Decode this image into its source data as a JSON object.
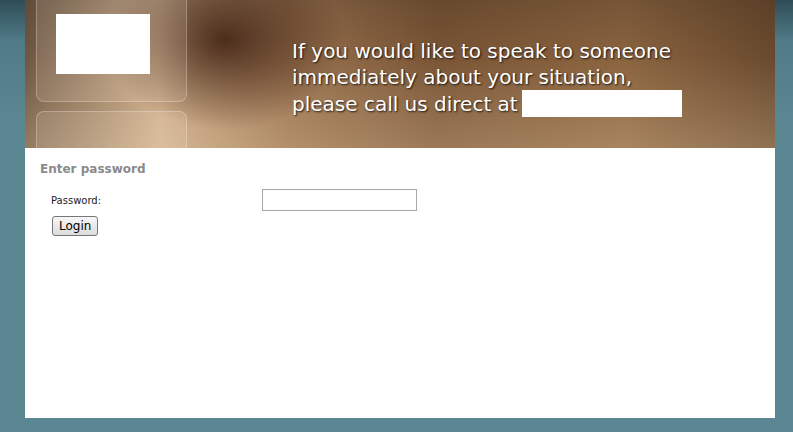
{
  "header": {
    "message_lines": [
      "If you would like to speak to someone",
      "immediately about your situation,",
      "please call us direct at"
    ]
  },
  "form": {
    "title": "Enter password",
    "fields": [
      {
        "label": "Password:",
        "value": ""
      }
    ],
    "buttons": [
      "Login"
    ]
  }
}
